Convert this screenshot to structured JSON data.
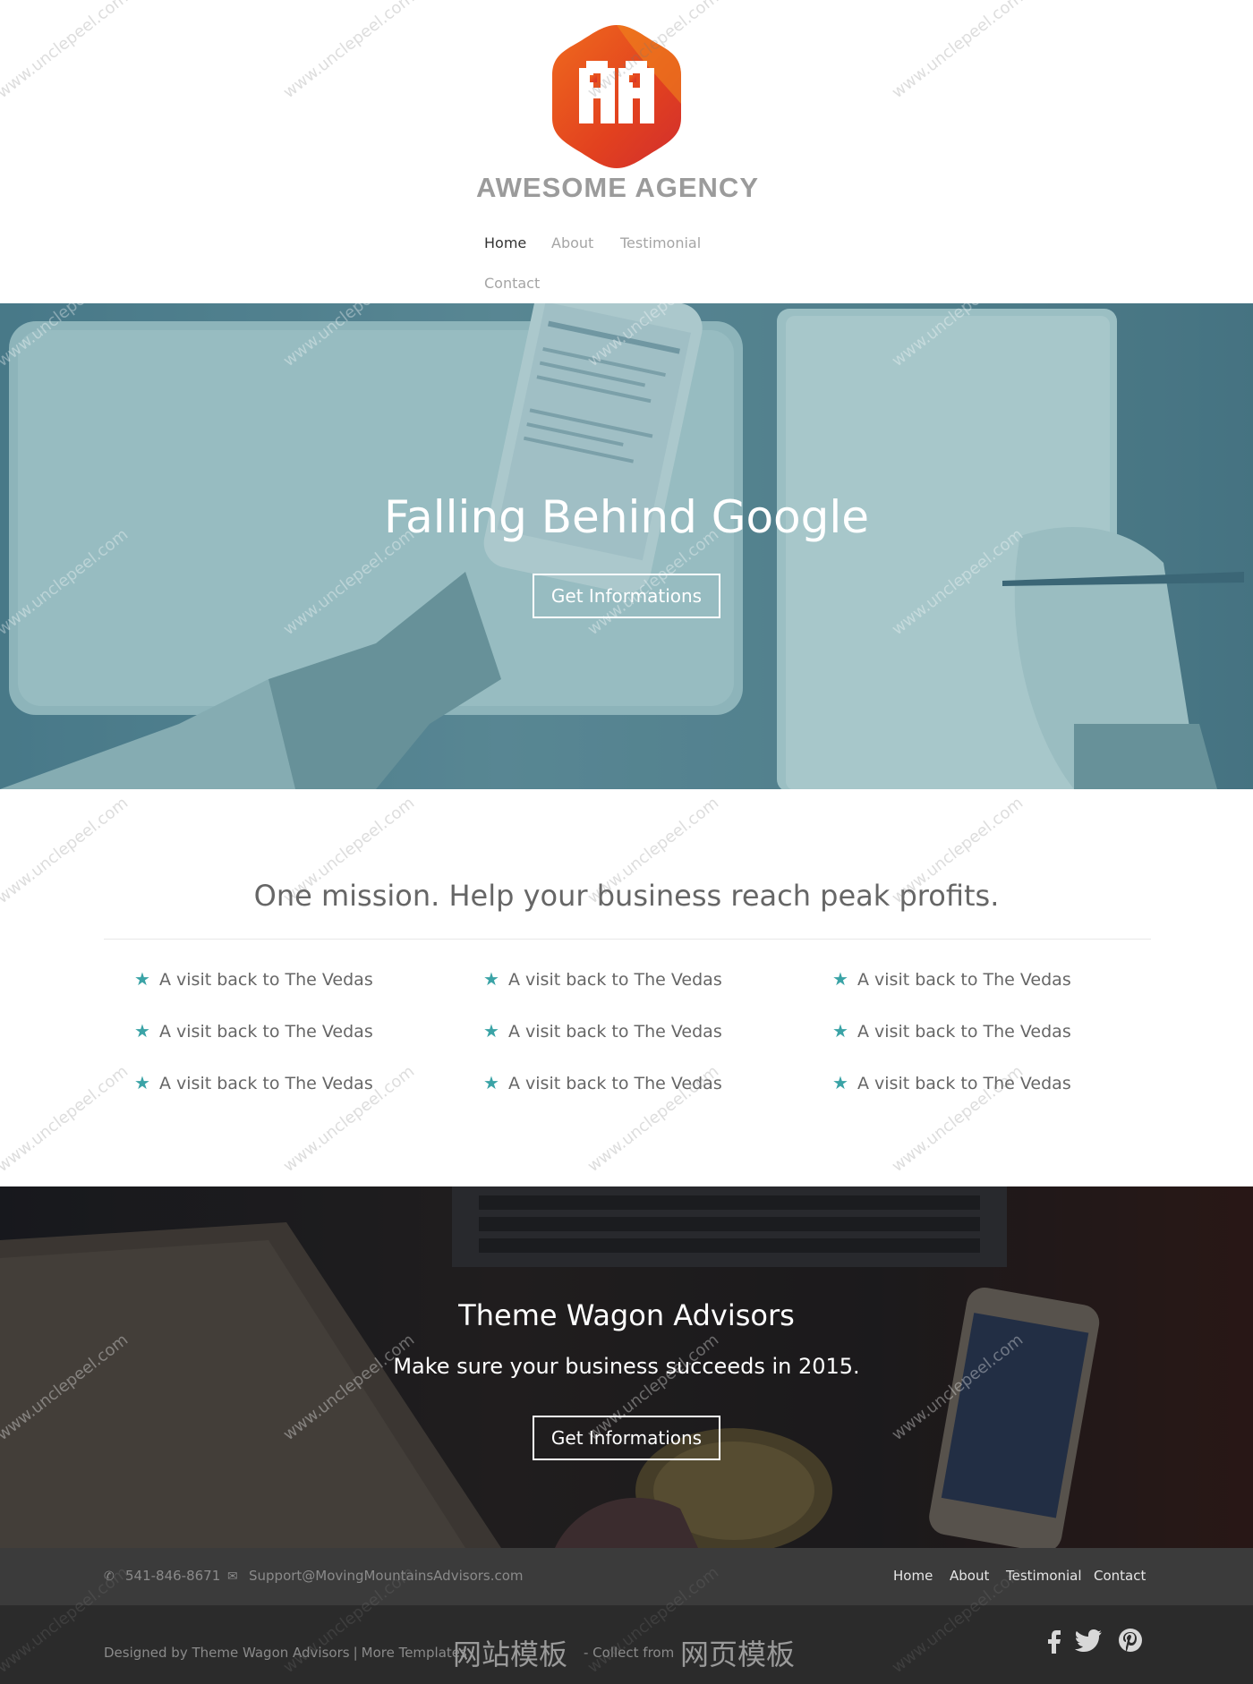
{
  "brand": {
    "name": "AWESOME AGENCY",
    "logo_colors": [
      "#e2411f",
      "#f08a1c",
      "#d42a2a"
    ]
  },
  "nav": {
    "items": [
      "Home",
      "About",
      "Testimonial",
      "Contact"
    ],
    "active": "Home"
  },
  "hero": {
    "title": "Falling Behind Google",
    "button_label": "Get Informations"
  },
  "mission": {
    "title": "One mission. Help your business reach peak profits.",
    "features": [
      "A visit back to The Vedas",
      "A visit back to The Vedas",
      "A visit back to The Vedas",
      "A visit back to The Vedas",
      "A visit back to The Vedas",
      "A visit back to The Vedas",
      "A visit back to The Vedas",
      "A visit back to The Vedas",
      "A visit back to The Vedas"
    ],
    "star_icon": "star-icon",
    "accent_color": "#3aa3a6"
  },
  "cta": {
    "title": "Theme Wagon Advisors",
    "subtitle": "Make sure your business succeeds in 2015.",
    "button_label": "Get Informations"
  },
  "footer": {
    "phone": "541-846-8671",
    "email": "Support@MovingMountainsAdvisors.com",
    "nav": [
      "Home",
      "About",
      "Testimonial",
      "Contact"
    ],
    "credit_designed": "Designed by Theme Wagon Advisors",
    "credit_sep": "|",
    "credit_more": "More Templates",
    "cjk_left": "网站模板",
    "collect": "- Collect from",
    "cjk_right": "网页模板",
    "social": [
      "facebook-icon",
      "twitter-icon",
      "pinterest-icon"
    ]
  },
  "watermark": {
    "text": "www.unclepeel.com"
  }
}
